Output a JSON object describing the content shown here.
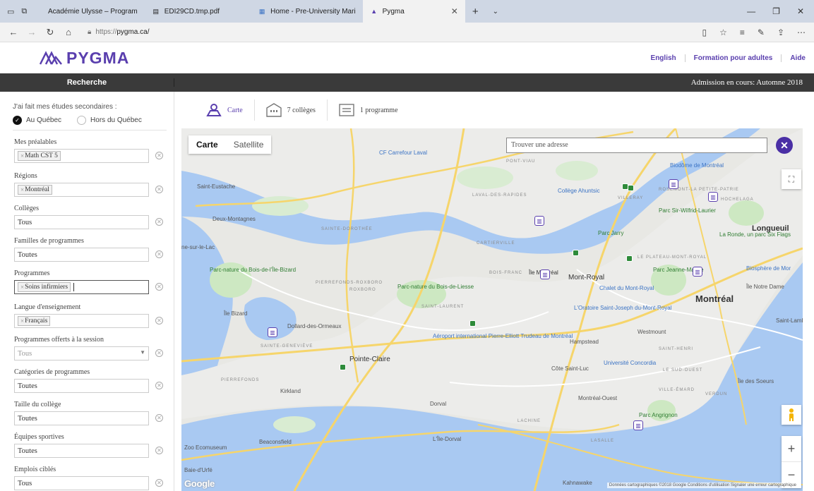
{
  "browser": {
    "tabs": [
      {
        "label": "Académie Ulysse – Program"
      },
      {
        "label": "EDI29CD.tmp.pdf"
      },
      {
        "label": "Home - Pre-University Mari"
      },
      {
        "label": "Pygma"
      }
    ],
    "url_prefix": "https://",
    "url_host": "pygma.ca/"
  },
  "header": {
    "logo_text": "PYGMA",
    "nav": [
      "English",
      "Formation pour adultes",
      "Aide"
    ]
  },
  "bar": {
    "search_label": "Recherche",
    "admission": "Admission en cours: Automne 2018"
  },
  "sidebar": {
    "studies_label": "J'ai fait mes études secondaires :",
    "option_quebec": "Au Québec",
    "option_outside": "Hors du Québec",
    "fields": {
      "prealables": {
        "label": "Mes préalables",
        "tag": "Math CST 5"
      },
      "regions": {
        "label": "Régions",
        "tag": "Montréal"
      },
      "colleges": {
        "label": "Collèges",
        "value": "Tous"
      },
      "familles": {
        "label": "Familles de programmes",
        "value": "Toutes"
      },
      "programmes": {
        "label": "Programmes",
        "tag": "Soins infirmiers"
      },
      "langue": {
        "label": "Langue d'enseignement",
        "tag": "Français"
      },
      "session": {
        "label": "Programmes offerts à la session",
        "value": "Tous"
      },
      "categories": {
        "label": "Catégories de programmes",
        "value": "Toutes"
      },
      "taille": {
        "label": "Taille du collège",
        "value": "Toutes"
      },
      "equipes": {
        "label": "Équipes sportives",
        "value": "Toutes"
      },
      "emplois": {
        "label": "Emplois ciblés",
        "value": "Tous"
      }
    }
  },
  "views": {
    "map": "Carte",
    "colleges": "7 collèges",
    "programs": "1 programme"
  },
  "map": {
    "type_map": "Carte",
    "type_satellite": "Satellite",
    "search_placeholder": "Trouver une adresse",
    "google": "Google",
    "attribution": "Données cartographiques ©2018 Google   Conditions d'utilisation   Signaler une erreur cartographique",
    "labels": {
      "montreal": "Montréal",
      "longueuil": "Longueuil",
      "saint_eustache": "Saint-Eustache",
      "deux_montagnes": "Deux-Montagnes",
      "mont_royal": "Mont-Royal",
      "pointe_claire": "Pointe-Claire",
      "dorval": "Dorval",
      "kirkland": "Kirkland",
      "hampstead": "Hampstead",
      "westmount": "Westmount",
      "cote_saint_luc": "Côte Saint-Luc",
      "montreal_ouest": "Montréal-Ouest",
      "ile_bizard": "Île Bizard",
      "dollard": "Dollard-des-Ormeaux",
      "beaconsfield": "Beaconsfield",
      "baie_durfe": "Baie-d'Urfé",
      "kahnawake": "Kahnawake",
      "ile_des_soeurs": "Île des Soeurs",
      "saint_lambert": "Saint-Lambert",
      "parc_jarry": "Parc Jarry",
      "parc_jeanne_mance": "Parc Jeanne-Mance",
      "chalet": "Chalet du Mont-Royal",
      "oratoire": "L'Oratoire Saint-Joseph du-Mont-Royal",
      "aeroport": "Aéroport international Pierre-Elliott Trudeau de Montréal",
      "cf_carrefour": "CF Carrefour Laval",
      "college_ahuntsic": "Collège Ahuntsic",
      "biodome": "Biodôme de Montréal",
      "parc_nature_bois_ile_bizard": "Parc-nature du Bois-de-l'Île-Bizard",
      "parc_nature_liesse": "Parc-nature du Bois-de-Liesse",
      "universite_concordia": "Université Concordia",
      "parc_sir_wilfrid": "Parc Sir-Wilfrid-Laurier",
      "la_ronde": "La Ronde, un parc Six Flags",
      "biosphere": "Biosphère de Mor",
      "ile_notre_dame": "Île Notre Dame",
      "ile_montreal": "Île Montréal",
      "lac": "ne-sur-le-Lac",
      "lile_dorval": "L'Île-Dorval",
      "zoo": "Zoo Ecomuseum",
      "parc_angrignon": "Parc Angrignon",
      "pont_viau": "PONT-VIAU",
      "laval_rapides": "LAVAL-DES-RAPIDES",
      "sainte_dorothee": "SAINTE-DOROTHÉE",
      "cartierville": "CARTIERVILLE",
      "saint_laurent": "SAINT-LAURENT",
      "sainte_genevieve": "SAINTE-GENEVIÈVE",
      "pierrefonds": "PIERREFONDS",
      "lachine": "LACHINE",
      "lasalle": "LASALLE",
      "plateau": "LE PLATEAU-MONT-ROYAL",
      "verdun": "VERDUN",
      "ville_emard": "VILLE-ÉMARD",
      "rosemont": "ROSEMONT-LA PETITE-PATRIE",
      "villeray": "VILLERAY",
      "hochelaga": "HOCHELAGA",
      "sud_ouest": "LE SUD-OUEST",
      "saint_henri": "SAINT-HENRI",
      "roxboro": "ROXBORO",
      "pierrefonds_roxboro": "PIERREFONDS-ROXBORO",
      "bois_franc": "BOIS-FRANC"
    }
  },
  "colors": {
    "brand": "#5a3fae",
    "dark_bar": "#3a3a3a",
    "water": "#a9c9f2",
    "land": "#e8e8e4",
    "park": "#cde8c2",
    "highway": "#f6d56b"
  }
}
